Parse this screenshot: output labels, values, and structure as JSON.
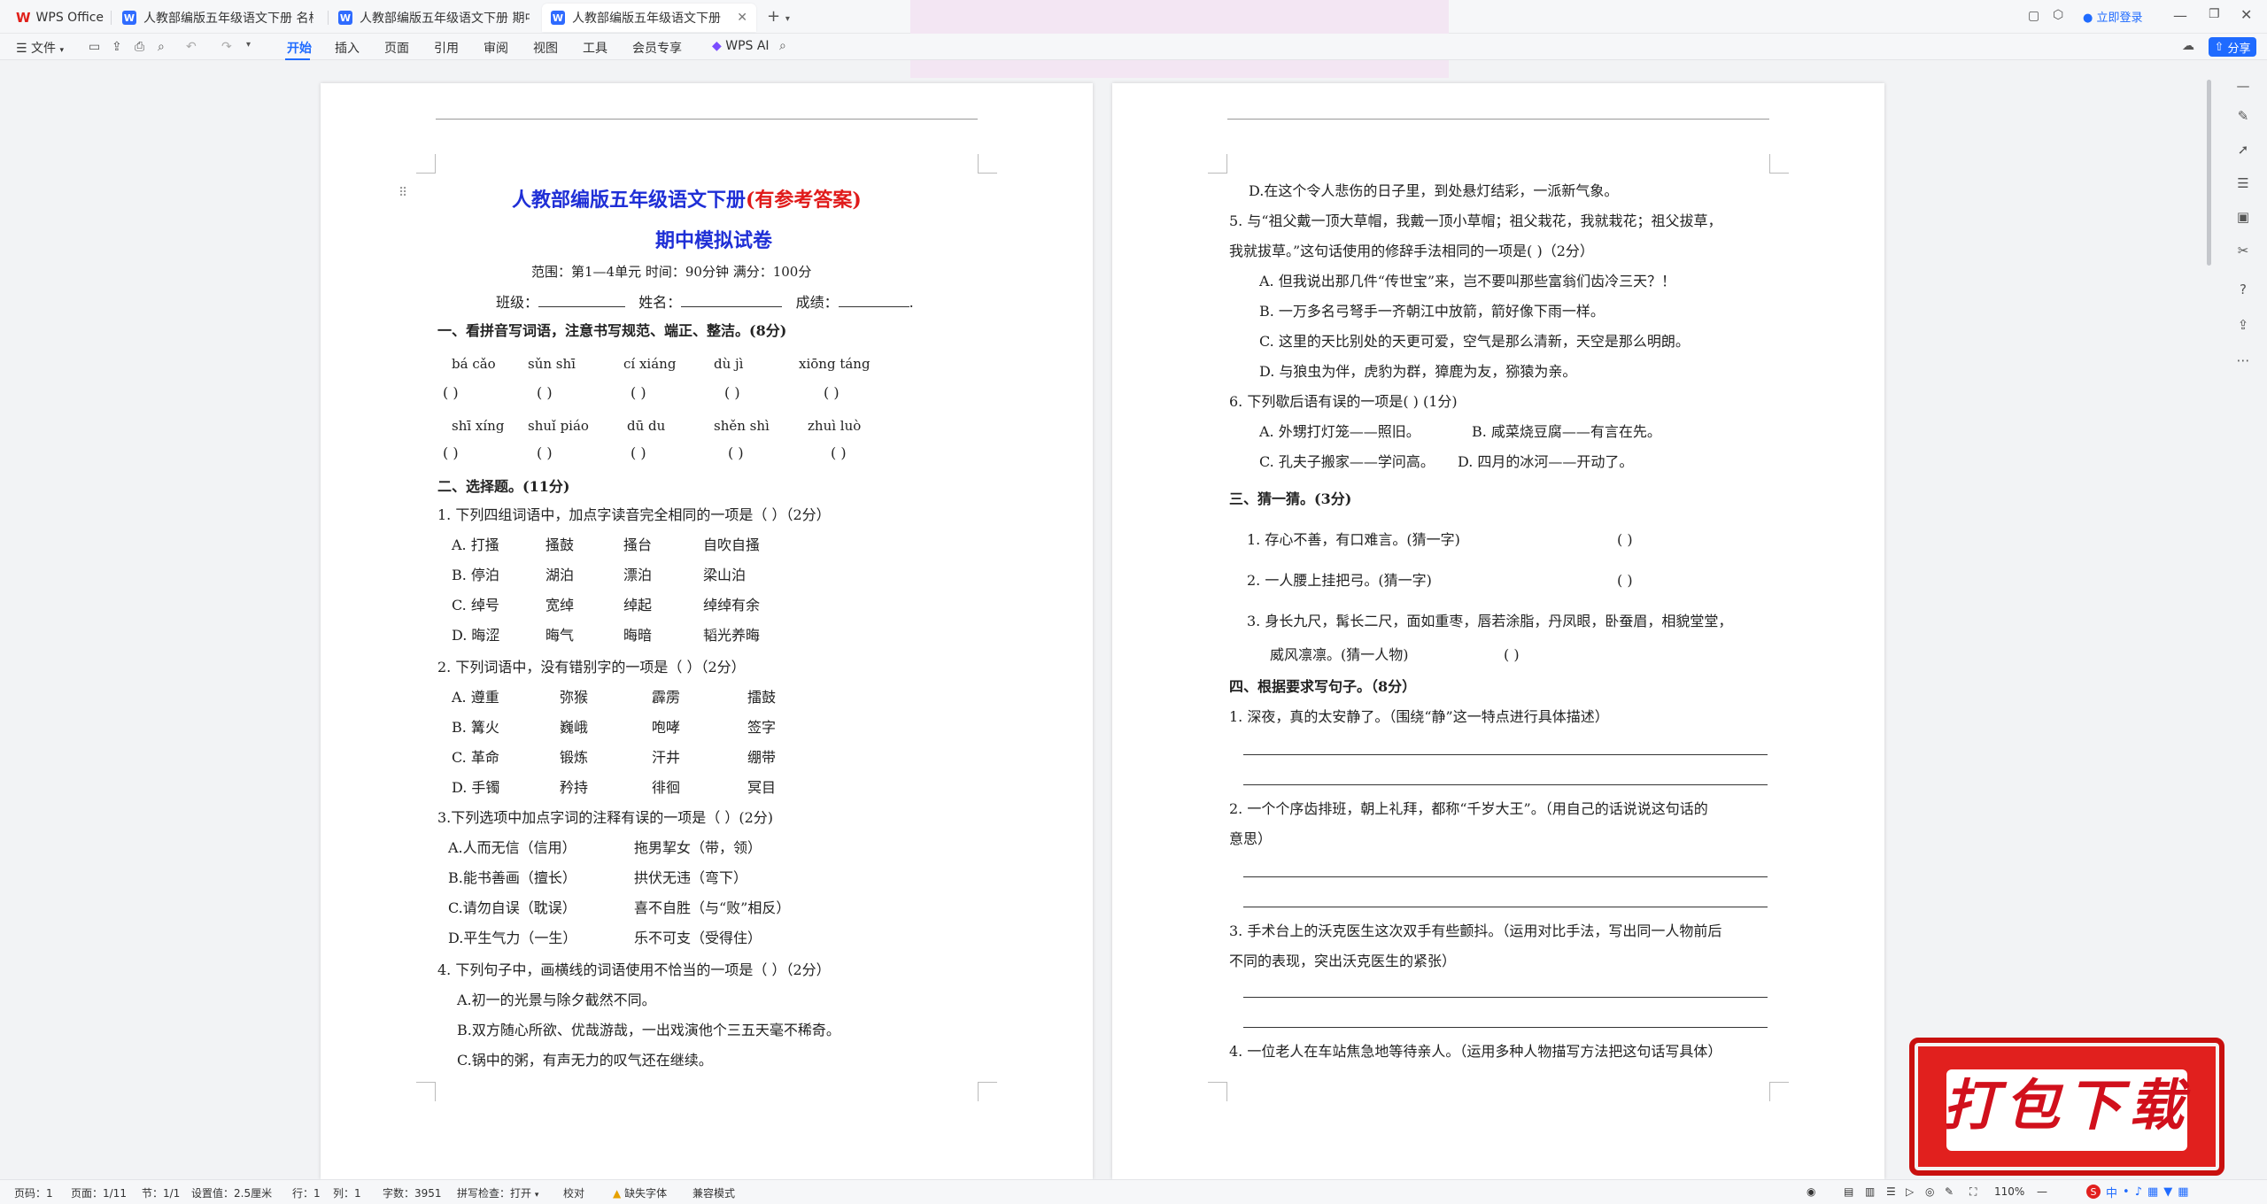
{
  "app": {
    "name": "WPS Office"
  },
  "tabs": [
    {
      "label": "人教部编版五年级语文下册 名校期中"
    },
    {
      "label": "人教部编版五年级语文下册 期中测评"
    },
    {
      "label": "人教部编版五年级语文下册 期中"
    }
  ],
  "titlebar": {
    "login": "立即登录",
    "new_tab": "+"
  },
  "ribbon": {
    "file": "文件",
    "menus": [
      "开始",
      "插入",
      "页面",
      "引用",
      "审阅",
      "视图",
      "工具",
      "会员专享",
      "WPS AI"
    ],
    "share": "分享"
  },
  "doc": {
    "title_blue": "人教部编版五年级语文下册",
    "title_red": "(有参考答案)",
    "subtitle": "期中模拟试卷",
    "scope": "范围：第1—4单元   时间：90分钟   满分：100分",
    "info": "班级：",
    "info_name": "姓名：",
    "info_score": "成绩：",
    "s1": "一、看拼音写词语，注意书写规范、端正、整洁。(8分)",
    "pinyin_row1": [
      "bá cǎo",
      "sǔn shī",
      "cí xiáng",
      "dù jì",
      "xiōng táng"
    ],
    "pinyin_row2": [
      "shī xíng",
      "shuǐ piáo",
      "dū du",
      "shěn shì",
      "zhuì luò"
    ],
    "paren": "(        )",
    "s2": "二、选择题。(11分)",
    "q1": "1. 下列四组词语中，加点字读音完全相同的一项是（      ）（2分）",
    "q1_rows": [
      [
        "A. 打搔",
        "搔鼓",
        "搔台",
        "自吹自搔"
      ],
      [
        "B. 停泊",
        "湖泊",
        "漂泊",
        "梁山泊"
      ],
      [
        "C. 绰号",
        "宽绰",
        "绰起",
        "绰绰有余"
      ],
      [
        "D. 晦涩",
        "晦气",
        "晦暗",
        "韬光养晦"
      ]
    ],
    "q2": "2.  下列词语中，没有错别字的一项是（      ）（2分）",
    "q2_rows": [
      [
        "A. 遵重",
        "弥猴",
        "霹雳",
        "擂鼓"
      ],
      [
        "B. 篝火",
        "巍峨",
        "咆哮",
        "签字"
      ],
      [
        "C. 革命",
        "锻炼",
        "汗井",
        "绷带"
      ],
      [
        "D. 手镯",
        "矜持",
        "徘徊",
        "冥目"
      ]
    ],
    "q3": "3.下列选项中加点字词的注释有误的一项是（      ）(2分)",
    "q3_rows": [
      [
        "A.人而无信（信用）",
        "拖男挈女（带，领）"
      ],
      [
        "B.能书善画（擅长）",
        "拱伏无违（弯下）"
      ],
      [
        "C.请勿自误（耽误）",
        "喜不自胜（与“败”相反）"
      ],
      [
        "D.平生气力（一生）",
        "乐不可支（受得住）"
      ]
    ],
    "q4": "4.  下列句子中，画横线的词语使用不恰当的一项是（      ）（2分）",
    "q4_a": "A.初一的光景与除夕截然不同。",
    "q4_b": "B.双方随心所欲、优哉游哉，一出戏演他个三五天毫不稀奇。",
    "q4_c": "C.锅中的粥，有声无力的叹气还在继续。",
    "q4_d": "D.在这个令人悲伤的日子里，到处悬灯结彩，一派新气象。",
    "q5": "5. 与“祖父戴一顶大草帽，我戴一顶小草帽；祖父栽花，我就栽花；祖父拔草，",
    "q5b": "我就拔草。”这句话使用的修辞手法相同的一项是(      )（2分）",
    "q5_opts": [
      "A. 但我说出那几件“传世宝”来，岂不要叫那些富翁们齿冷三天？！",
      "B. 一万多名弓弩手一齐朝江中放箭，箭好像下雨一样。",
      "C. 这里的天比别处的天更可爱，空气是那么清新，天空是那么明朗。",
      "D. 与狼虫为伴，虎豹为群，獐鹿为友，猕猿为亲。"
    ],
    "q6": "6. 下列歇后语有误的一项是(      ) (1分)",
    "q6_opts": [
      [
        "A. 外甥打灯笼——照旧。",
        "B. 咸菜烧豆腐——有言在先。"
      ],
      [
        "C. 孔夫子搬家——学问高。",
        "D. 四月的冰河——开动了。"
      ]
    ],
    "s3": "三、猜一猜。(3分)",
    "g1": "1.  存心不善，有口难言。(猜一字)",
    "g2": "2.  一人腰上挂把弓。(猜一字)",
    "g3": "3.  身长九尺，髯长二尺，面如重枣，唇若涂脂，丹凤眼，卧蚕眉，相貌堂堂，",
    "g3b": "威风凛凛。(猜一人物)",
    "g_paren": "(            )",
    "s4": "四、根据要求写句子。（8分）",
    "w1": "1. 深夜，真的太安静了。（围绕“静”这一特点进行具体描述）",
    "w2": "2. 一个个序齿排班，朝上礼拜，都称“千岁大王”。（用自己的话说说这句话的",
    "w2b": "意思）",
    "w3": "3. 手术台上的沃克医生这次双手有些颤抖。（运用对比手法，写出同一人物前后",
    "w3b": "不同的表现，突出沃克医生的紧张）",
    "w4": "4. 一位老人在车站焦急地等待亲人。（运用多种人物描写方法把这句话写具体）"
  },
  "status": {
    "page": "页码：1",
    "pages": "页面：1/11",
    "section": "节：1/1",
    "setting": "设置值：2.5厘米",
    "row": "行：1",
    "col": "列：1",
    "words": "字数：3951",
    "spell": "拼写检查：打开",
    "proof": "校对",
    "font_missing": "缺失字体",
    "compat": "兼容模式",
    "zoom": "110%"
  },
  "download_banner": "打包下载",
  "colors": {
    "accent": "#1f6bff",
    "title_blue": "#1f2fd6",
    "title_red": "#e01b1b",
    "banner_red": "#e1201e"
  }
}
